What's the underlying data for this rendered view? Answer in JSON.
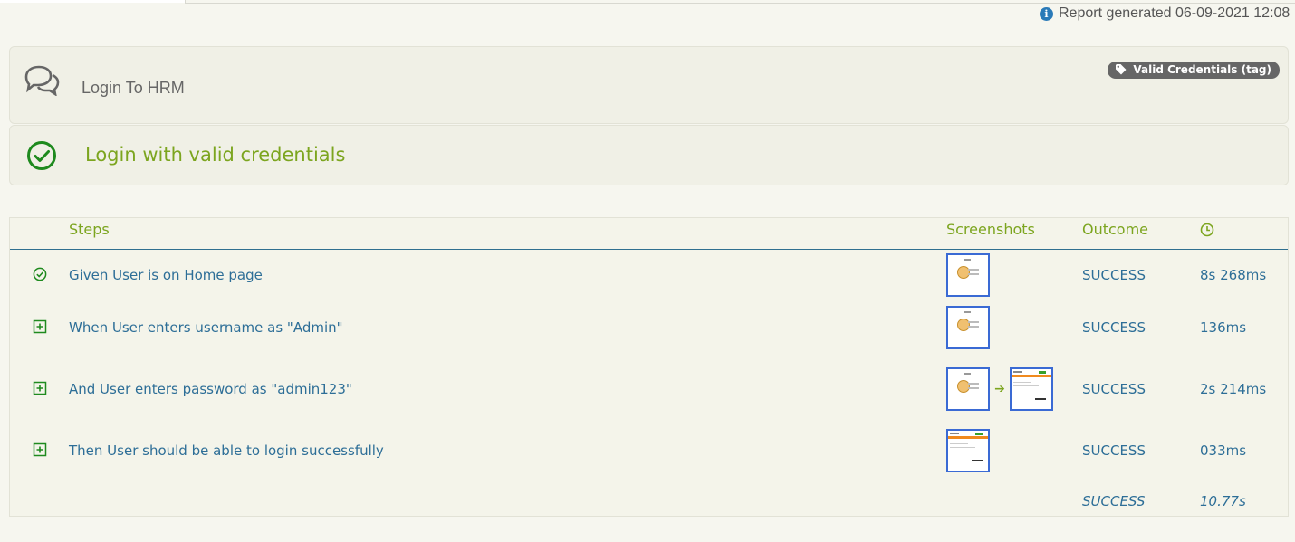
{
  "report": {
    "generated_text": "Report generated 06-09-2021 12:08"
  },
  "feature": {
    "title": "Login To HRM",
    "tag": "Valid Credentials (tag)"
  },
  "scenario": {
    "title": "Login with valid credentials"
  },
  "table": {
    "headers": {
      "steps": "Steps",
      "screenshots": "Screenshots",
      "outcome": "Outcome",
      "duration_icon": "clock-icon"
    },
    "rows": [
      {
        "icon": "check-circle-icon",
        "description": "Given User is on Home page",
        "screenshots": [
          "login-page"
        ],
        "outcome": "SUCCESS",
        "duration": "8s 268ms"
      },
      {
        "icon": "expand-plus-icon",
        "description": "When User enters username as \"Admin\"",
        "screenshots": [
          "login-page"
        ],
        "outcome": "SUCCESS",
        "duration": "136ms"
      },
      {
        "icon": "expand-plus-icon",
        "description": "And User enters password as \"admin123\"",
        "screenshots": [
          "login-page",
          "dashboard-page"
        ],
        "outcome": "SUCCESS",
        "duration": "2s 214ms"
      },
      {
        "icon": "expand-plus-icon",
        "description": "Then User should be able to login successfully",
        "screenshots": [
          "dashboard-page"
        ],
        "outcome": "SUCCESS",
        "duration": "033ms"
      }
    ],
    "total": {
      "outcome": "SUCCESS",
      "duration": "10.77s"
    }
  },
  "colors": {
    "success_green": "#7ca51f",
    "link_blue": "#2d6e97",
    "icon_green": "#1e8a1e",
    "thumb_border": "#3a6ad4"
  }
}
